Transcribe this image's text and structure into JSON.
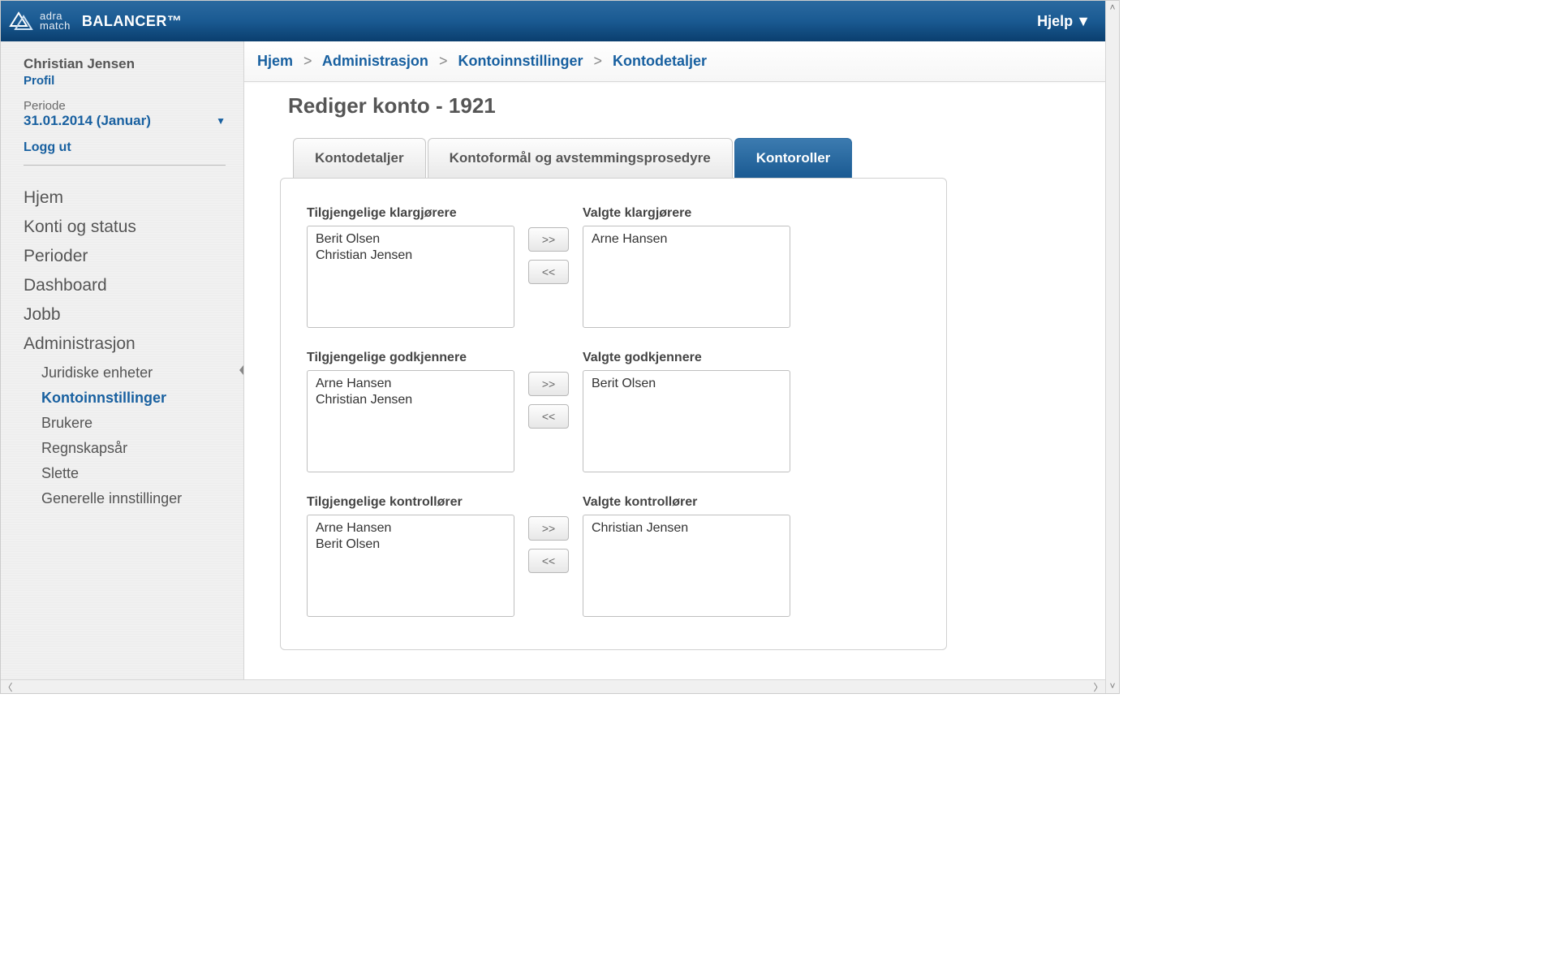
{
  "header": {
    "app_title": "BALANCER™",
    "logo_line1": "adra",
    "logo_line2": "match",
    "help_label": "Hjelp"
  },
  "sidebar": {
    "user_name": "Christian Jensen",
    "profile_label": "Profil",
    "period_label": "Periode",
    "period_value": "31.01.2014 (Januar)",
    "logout_label": "Logg ut",
    "nav": {
      "home": "Hjem",
      "accounts": "Konti og status",
      "periods": "Perioder",
      "dashboard": "Dashboard",
      "job": "Jobb",
      "admin": "Administrasjon"
    },
    "subnav": {
      "legal": "Juridiske enheter",
      "account_settings": "Kontoinnstillinger",
      "users": "Brukere",
      "fiscal": "Regnskapsår",
      "delete": "Slette",
      "general": "Generelle innstillinger"
    }
  },
  "breadcrumb": {
    "home": "Hjem",
    "admin": "Administrasjon",
    "account_settings": "Kontoinnstillinger",
    "details": "Kontodetaljer"
  },
  "page": {
    "heading": "Rediger konto - 1921"
  },
  "tabs": {
    "details": "Kontodetaljer",
    "purpose": "Kontoformål og avstemmingsprosedyre",
    "roles": "Kontoroller"
  },
  "roles": {
    "preparers": {
      "available_label": "Tilgjengelige klargjørere",
      "selected_label": "Valgte klargjørere",
      "available": [
        "Berit Olsen",
        "Christian Jensen"
      ],
      "selected": [
        "Arne Hansen"
      ]
    },
    "approvers": {
      "available_label": "Tilgjengelige godkjennere",
      "selected_label": "Valgte godkjennere",
      "available": [
        "Arne Hansen",
        "Christian Jensen"
      ],
      "selected": [
        "Berit Olsen"
      ]
    },
    "controllers": {
      "available_label": "Tilgjengelige kontrollører",
      "selected_label": "Valgte kontrollører",
      "available": [
        "Arne Hansen",
        "Berit Olsen"
      ],
      "selected": [
        "Christian Jensen"
      ]
    },
    "move_right": ">>",
    "move_left": "<<"
  }
}
